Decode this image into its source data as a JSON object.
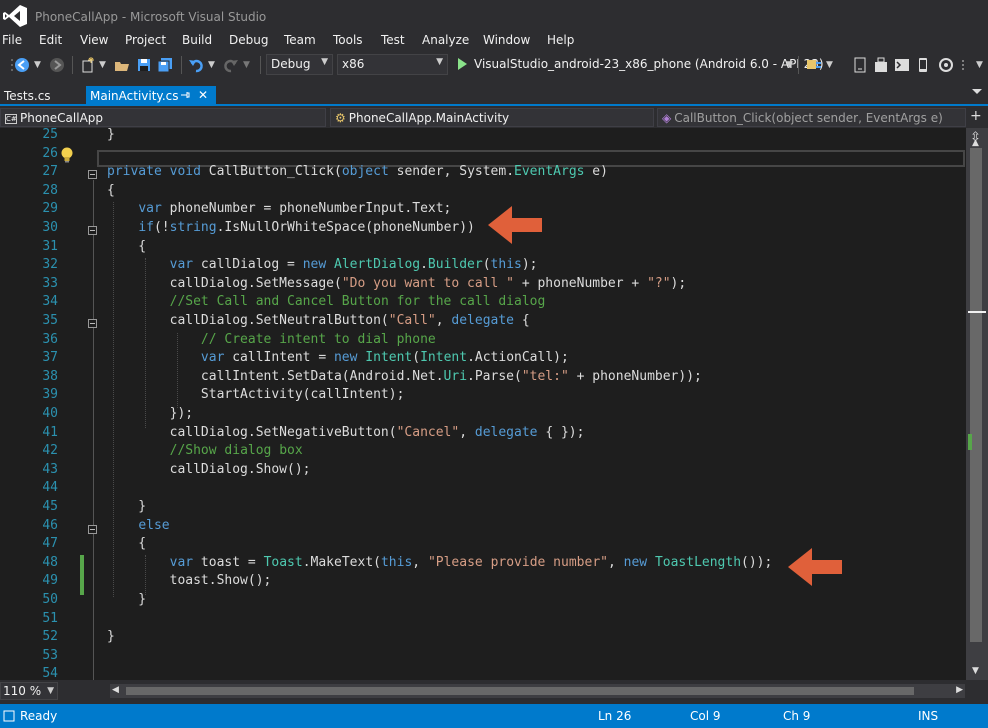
{
  "window": {
    "title": "PhoneCallApp - Microsoft Visual Studio"
  },
  "menu": {
    "items": [
      {
        "label": "File"
      },
      {
        "label": "Edit"
      },
      {
        "label": "View"
      },
      {
        "label": "Project"
      },
      {
        "label": "Build"
      },
      {
        "label": "Debug"
      },
      {
        "label": "Team"
      },
      {
        "label": "Tools"
      },
      {
        "label": "Test"
      },
      {
        "label": "Analyze"
      },
      {
        "label": "Window"
      },
      {
        "label": "Help"
      }
    ]
  },
  "toolbar": {
    "configuration": "Debug",
    "platform": "x86",
    "run_target": "VisualStudio_android-23_x86_phone (Android 6.0 - API 23)"
  },
  "tabs": [
    {
      "label": "Tests.cs",
      "active": false
    },
    {
      "label": "MainActivity.cs",
      "active": true
    }
  ],
  "navigation": {
    "project": "PhoneCallApp",
    "type": "PhoneCallApp.MainActivity",
    "member": "CallButton_Click(object sender, EventArgs e)"
  },
  "editor": {
    "lines": [
      {
        "num": "25",
        "tokens": [
          [
            "p",
            "}"
          ]
        ]
      },
      {
        "num": "26",
        "tokens": []
      },
      {
        "num": "27",
        "tokens": [
          [
            "k",
            "private"
          ],
          [
            "p",
            " "
          ],
          [
            "k",
            "void"
          ],
          [
            "p",
            " CallButton_Click("
          ],
          [
            "k",
            "object"
          ],
          [
            "p",
            " sender, System."
          ],
          [
            "t",
            "EventArgs"
          ],
          [
            "p",
            " e)"
          ]
        ]
      },
      {
        "num": "28",
        "tokens": [
          [
            "p",
            "{"
          ]
        ]
      },
      {
        "num": "29",
        "tokens": [
          [
            "p",
            "    "
          ],
          [
            "k",
            "var"
          ],
          [
            "p",
            " phoneNumber = phoneNumberInput.Text;"
          ]
        ]
      },
      {
        "num": "30",
        "tokens": [
          [
            "p",
            "    "
          ],
          [
            "k",
            "if"
          ],
          [
            "p",
            "(!"
          ],
          [
            "k",
            "string"
          ],
          [
            "p",
            ".IsNullOrWhiteSpace(phoneNumber))"
          ]
        ]
      },
      {
        "num": "31",
        "tokens": [
          [
            "p",
            "    {"
          ]
        ]
      },
      {
        "num": "32",
        "tokens": [
          [
            "p",
            "        "
          ],
          [
            "k",
            "var"
          ],
          [
            "p",
            " callDialog = "
          ],
          [
            "k",
            "new"
          ],
          [
            "p",
            " "
          ],
          [
            "t",
            "AlertDialog"
          ],
          [
            "p",
            "."
          ],
          [
            "t",
            "Builder"
          ],
          [
            "p",
            "("
          ],
          [
            "k",
            "this"
          ],
          [
            "p",
            ");"
          ]
        ]
      },
      {
        "num": "33",
        "tokens": [
          [
            "p",
            "        callDialog.SetMessage("
          ],
          [
            "s",
            "\"Do you want to call \""
          ],
          [
            "p",
            " + phoneNumber + "
          ],
          [
            "s",
            "\"?\""
          ],
          [
            "p",
            ");"
          ]
        ]
      },
      {
        "num": "34",
        "tokens": [
          [
            "p",
            "        "
          ],
          [
            "c",
            "//Set Call and Cancel Button for the call dialog"
          ]
        ]
      },
      {
        "num": "35",
        "tokens": [
          [
            "p",
            "        callDialog.SetNeutralButton("
          ],
          [
            "s",
            "\"Call\""
          ],
          [
            "p",
            ", "
          ],
          [
            "k",
            "delegate"
          ],
          [
            "p",
            " {"
          ]
        ]
      },
      {
        "num": "36",
        "tokens": [
          [
            "p",
            "            "
          ],
          [
            "c",
            "// Create intent to dial phone"
          ]
        ]
      },
      {
        "num": "37",
        "tokens": [
          [
            "p",
            "            "
          ],
          [
            "k",
            "var"
          ],
          [
            "p",
            " callIntent = "
          ],
          [
            "k",
            "new"
          ],
          [
            "p",
            " "
          ],
          [
            "t",
            "Intent"
          ],
          [
            "p",
            "("
          ],
          [
            "t",
            "Intent"
          ],
          [
            "p",
            ".ActionCall);"
          ]
        ]
      },
      {
        "num": "38",
        "tokens": [
          [
            "p",
            "            callIntent.SetData(Android.Net."
          ],
          [
            "t",
            "Uri"
          ],
          [
            "p",
            ".Parse("
          ],
          [
            "s",
            "\"tel:\""
          ],
          [
            "p",
            " + phoneNumber));"
          ]
        ]
      },
      {
        "num": "39",
        "tokens": [
          [
            "p",
            "            StartActivity(callIntent);"
          ]
        ]
      },
      {
        "num": "40",
        "tokens": [
          [
            "p",
            "        });"
          ]
        ]
      },
      {
        "num": "41",
        "tokens": [
          [
            "p",
            "        callDialog.SetNegativeButton("
          ],
          [
            "s",
            "\"Cancel\""
          ],
          [
            "p",
            ", "
          ],
          [
            "k",
            "delegate"
          ],
          [
            "p",
            " { });"
          ]
        ]
      },
      {
        "num": "42",
        "tokens": [
          [
            "p",
            "        "
          ],
          [
            "c",
            "//Show dialog box"
          ]
        ]
      },
      {
        "num": "43",
        "tokens": [
          [
            "p",
            "        callDialog.Show();"
          ]
        ]
      },
      {
        "num": "44",
        "tokens": []
      },
      {
        "num": "45",
        "tokens": [
          [
            "p",
            "    }"
          ]
        ]
      },
      {
        "num": "46",
        "tokens": [
          [
            "p",
            "    "
          ],
          [
            "k",
            "else"
          ]
        ]
      },
      {
        "num": "47",
        "tokens": [
          [
            "p",
            "    {"
          ]
        ]
      },
      {
        "num": "48",
        "tokens": [
          [
            "p",
            "        "
          ],
          [
            "k",
            "var"
          ],
          [
            "p",
            " toast = "
          ],
          [
            "t",
            "Toast"
          ],
          [
            "p",
            ".MakeText("
          ],
          [
            "k",
            "this"
          ],
          [
            "p",
            ", "
          ],
          [
            "s",
            "\"Please provide number\""
          ],
          [
            "p",
            ", "
          ],
          [
            "k",
            "new"
          ],
          [
            "p",
            " "
          ],
          [
            "t",
            "ToastLength"
          ],
          [
            "p",
            "());"
          ]
        ]
      },
      {
        "num": "49",
        "tokens": [
          [
            "p",
            "        toast.Show();"
          ]
        ]
      },
      {
        "num": "50",
        "tokens": [
          [
            "p",
            "    }"
          ]
        ]
      },
      {
        "num": "51",
        "tokens": []
      },
      {
        "num": "52",
        "tokens": [
          [
            "p",
            "}"
          ]
        ]
      },
      {
        "num": "53",
        "tokens": []
      },
      {
        "num": "54",
        "tokens": []
      }
    ]
  },
  "zoom": "110 %",
  "status": {
    "state": "Ready",
    "line": "Ln 26",
    "col": "Col 9",
    "ch": "Ch 9",
    "mode": "INS"
  },
  "colors": {
    "accent": "#007acc",
    "annotation_arrow": "#e0603a",
    "keyword": "#569cd6",
    "type": "#4ec9b0",
    "string": "#d69d85",
    "comment": "#57a64a"
  }
}
